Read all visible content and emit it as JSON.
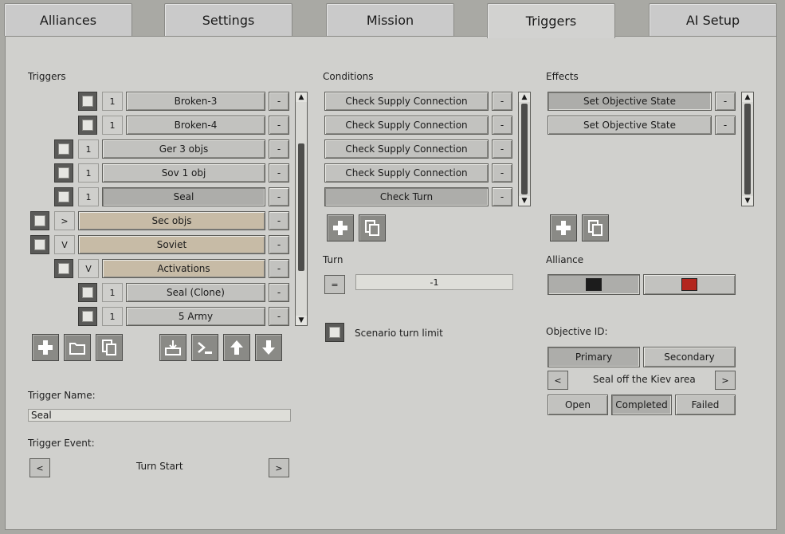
{
  "tabs": [
    {
      "label": "Alliances"
    },
    {
      "label": "Settings"
    },
    {
      "label": "Mission"
    },
    {
      "label": "Triggers"
    },
    {
      "label": "AI Setup"
    }
  ],
  "triggers": {
    "section_label": "Triggers",
    "items": [
      {
        "badge": "1",
        "label": "Broken-3",
        "remove": "-"
      },
      {
        "badge": "1",
        "label": "Broken-4",
        "remove": "-"
      },
      {
        "badge": "1",
        "label": "Ger 3 objs",
        "remove": "-"
      },
      {
        "badge": "1",
        "label": "Sov 1 obj",
        "remove": "-"
      },
      {
        "badge": "1",
        "label": "Seal",
        "remove": "-"
      },
      {
        "badge": ">",
        "label": "Sec objs",
        "remove": "-"
      },
      {
        "badge": "V",
        "label": "Soviet",
        "remove": "-"
      },
      {
        "badge": "V",
        "label": "Activations",
        "remove": "-"
      },
      {
        "badge": "1",
        "label": "Seal (Clone)",
        "remove": "-"
      },
      {
        "badge": "1",
        "label": "5 Army",
        "remove": "-"
      }
    ],
    "name_label": "Trigger Name:",
    "name_value": "Seal",
    "event_label": "Trigger Event:",
    "event_prev": "<",
    "event_value": "Turn Start",
    "event_next": ">"
  },
  "conditions": {
    "section_label": "Conditions",
    "items": [
      {
        "label": "Check Supply Connection",
        "remove": "-"
      },
      {
        "label": "Check Supply Connection",
        "remove": "-"
      },
      {
        "label": "Check Supply Connection",
        "remove": "-"
      },
      {
        "label": "Check Supply Connection",
        "remove": "-"
      },
      {
        "label": "Check Turn",
        "remove": "-"
      }
    ],
    "turn_label": "Turn",
    "turn_operator": "=",
    "turn_value": "-1",
    "scenario_limit_label": "Scenario turn limit"
  },
  "effects": {
    "section_label": "Effects",
    "items": [
      {
        "label": "Set Objective State",
        "remove": "-"
      },
      {
        "label": "Set Objective State",
        "remove": "-"
      }
    ],
    "alliance_label": "Alliance",
    "alliance_colors": [
      "#1c1c1c",
      "#b3261e"
    ],
    "objective_label": "Objective ID:",
    "primary_label": "Primary",
    "secondary_label": "Secondary",
    "objective_prev": "<",
    "objective_value": "Seal off the Kiev area",
    "objective_next": ">",
    "state_open": "Open",
    "state_completed": "Completed",
    "state_failed": "Failed"
  },
  "scroll_arrows": {
    "up": "▲",
    "down": "▼"
  }
}
